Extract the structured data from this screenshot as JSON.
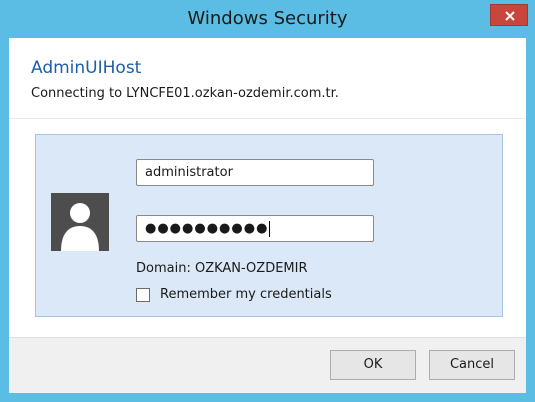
{
  "window": {
    "title": "Windows Security",
    "close_icon": "close-icon"
  },
  "dialog": {
    "app_name": "AdminUIHost",
    "message": "Connecting to LYNCFE01.ozkan-ozdemir.com.tr."
  },
  "credentials": {
    "avatar_icon": "user-silhouette-icon",
    "username_value": "administrator",
    "password_masked": "●●●●●●●●●●",
    "domain_text": "Domain: OZKAN-OZDEMIR",
    "remember_label": "Remember my credentials",
    "remember_checked": false
  },
  "buttons": {
    "ok_label": "OK",
    "cancel_label": "Cancel"
  },
  "colors": {
    "frame": "#5bbde4",
    "close_button": "#c7473e",
    "accent_text": "#1d5fa8",
    "panel_bg": "#dbe8f8"
  }
}
